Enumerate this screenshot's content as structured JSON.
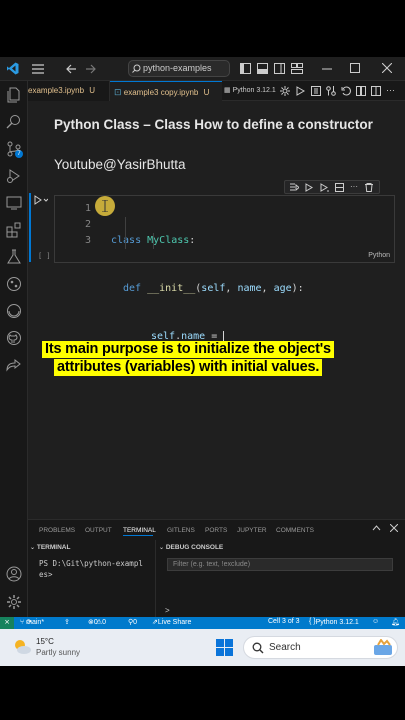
{
  "window": {
    "search_text": "python-examples"
  },
  "tabs": [
    {
      "label": "example3.ipynb",
      "badge": "U"
    },
    {
      "label": "example3 copy.ipynb",
      "badge": "U"
    }
  ],
  "kernel": {
    "label": "Python 3.12.1"
  },
  "notebook": {
    "heading": "Python Class – Class How to define a constructor",
    "subheading": "Youtube@YasirBhutta",
    "cell": {
      "line_numbers": [
        "1",
        "2",
        "3"
      ],
      "lines": [
        "class MyClass:",
        "def __init__(self, name, age):",
        "self.name = "
      ],
      "language": "Python",
      "exec_count": "[ ]"
    }
  },
  "caption": {
    "line1": "Its main purpose is to initialize the object's",
    "line2": "attributes (variables) with initial values."
  },
  "panel": {
    "tabs": [
      "PROBLEMS",
      "OUTPUT",
      "TERMINAL",
      "GITLENS",
      "PORTS",
      "JUPYTER",
      "COMMENTS"
    ],
    "active_tab": "TERMINAL",
    "terminal_title": "TERMINAL",
    "terminal_line1": "PS D:\\Git\\python-exampl",
    "terminal_line2": "es>",
    "debug_title": "DEBUG CONSOLE",
    "filter_placeholder": "Filter (e.g. text, !exclude)",
    "prompt": ">"
  },
  "status": {
    "branch": "main*",
    "problems": "0",
    "warnings": "0",
    "ports": "0",
    "live_share": "Live Share",
    "cell": "Cell 3 of 3",
    "python": "Python 3.12.1"
  },
  "taskbar": {
    "temperature": "15°C",
    "weather": "Partly sunny",
    "search_label": "Search"
  },
  "colors": {
    "accent": "#007acc",
    "caption_bg": "#ffff00"
  }
}
